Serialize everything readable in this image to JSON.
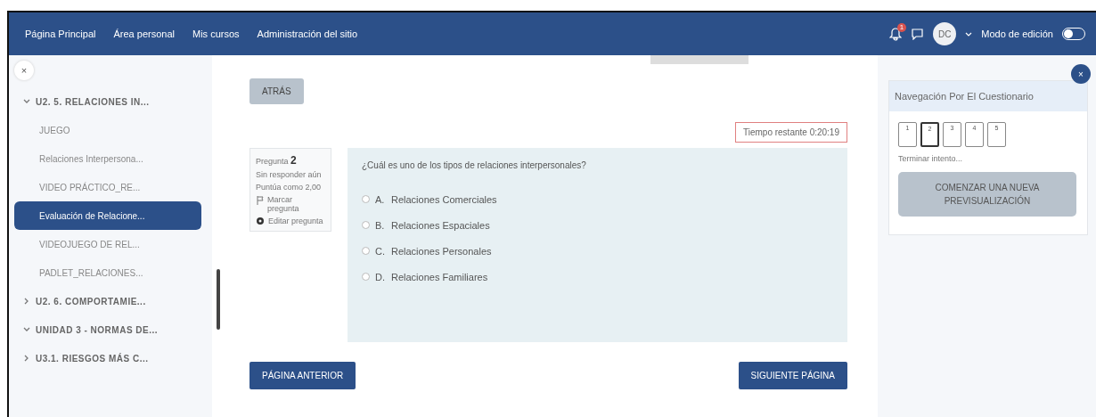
{
  "navbar": {
    "links": [
      "Página Principal",
      "Área personal",
      "Mis cursos",
      "Administración del sitio"
    ],
    "notification_count": "1",
    "avatar": "DC",
    "edit_mode": {
      "label": "Modo de edición",
      "on": false
    }
  },
  "course_index": {
    "close": "×",
    "items": [
      {
        "label": "U2. 5. RELACIONES IN...",
        "kind": "section",
        "expanded": true,
        "children": [
          {
            "label": "JUEGO",
            "kind": "activity",
            "selected": false
          },
          {
            "label": "Relaciones Interpersona...",
            "kind": "activity",
            "selected": false
          },
          {
            "label": "VIDEO PRÁCTICO_RE...",
            "kind": "activity",
            "selected": false
          },
          {
            "label": "Evaluación de Relacione...",
            "kind": "activity",
            "selected": true
          },
          {
            "label": "VIDEOJUEGO DE REL...",
            "kind": "activity",
            "selected": false
          },
          {
            "label": "PADLET_RELACIONES...",
            "kind": "activity",
            "selected": false
          }
        ]
      },
      {
        "label": "U2. 6. COMPORTAMIE...",
        "kind": "section",
        "expanded": false
      },
      {
        "label": "UNIDAD 3 - NORMAS DE...",
        "kind": "section",
        "expanded": true,
        "children": [
          {
            "label": "U3.1. RIESGOS MÁS C...",
            "kind": "section",
            "expanded": false
          }
        ]
      }
    ]
  },
  "main": {
    "back_button": "ATRÁS",
    "timer": "Tiempo restante 0:20:19",
    "question_info": {
      "title": "Pregunta **2**",
      "status": "Sin responder aún",
      "points": "Puntúa como 2,00",
      "flag": "Marcar pregunta",
      "edit": "Editar pregunta"
    },
    "question": {
      "text": "¿Cuál es uno de los tipos de relaciones interpersonales?",
      "options": [
        {
          "letter": "A.",
          "label": "Relaciones Comerciales",
          "selected": false
        },
        {
          "letter": "B.",
          "label": "Relaciones Espaciales",
          "selected": false
        },
        {
          "letter": "C.",
          "label": "Relaciones Personales",
          "selected": false
        },
        {
          "letter": "D.",
          "label": "Relaciones Familiares",
          "selected": false
        }
      ]
    },
    "prev_button": "PÁGINA ANTERIOR",
    "next_button": "SIGUIENTE PÁGINA"
  },
  "quiz_navigation": {
    "title": "Navegación Por El Cuestionario",
    "questions": [
      {
        "label": "1",
        "selected": false
      },
      {
        "label": "2",
        "selected": true
      },
      {
        "label": "3",
        "selected": false
      },
      {
        "label": "4",
        "selected": false
      },
      {
        "label": "5",
        "selected": false
      }
    ],
    "finish_link": "Terminar intento...",
    "new_preview_button": "COMENZAR UNA NUEVA PREVISUALIZACIÓN"
  }
}
